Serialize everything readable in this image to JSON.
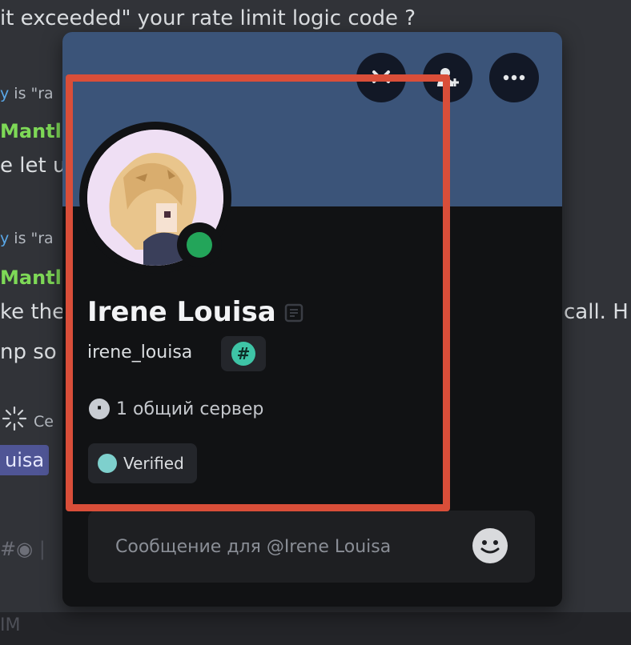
{
  "background": {
    "top_line": "it exceeded\"  your  rate limit logic code ?",
    "fragments": [
      {
        "key": "is_ra_1",
        "pre": "y",
        "text": " is  \"ra"
      },
      {
        "key": "mantle_1",
        "text": "Mantl"
      },
      {
        "key": "let_us",
        "text": "e let us"
      },
      {
        "key": "is_ra_2",
        "pre": "y",
        "text": " is  \"ra"
      },
      {
        "key": "mantle_2",
        "text": "Mantl"
      },
      {
        "key": "ke_the",
        "text": "ke the"
      },
      {
        "key": "np_so",
        "text": "np so"
      },
      {
        "key": "call_h",
        "text": "call.  H"
      },
      {
        "key": "ce",
        "text": "Ce"
      }
    ],
    "mention": "uisa",
    "bottom_fragment": "IM"
  },
  "popup": {
    "display_name": "Irene Louisa",
    "username": "irene_louisa",
    "hash_badge": "#",
    "mutual_servers": "1 общий сервер",
    "verified_label": "Verified",
    "message_placeholder": "Сообщение для @Irene Louisa",
    "status": "online",
    "colors": {
      "banner": "#3b5479",
      "status": "#23a55a",
      "highlight": "#d94e39",
      "hash_badge": "#3ec4a6",
      "verified_dot": "#7ed0cd"
    },
    "top_buttons": [
      {
        "name": "call-icon"
      },
      {
        "name": "add-friend-icon"
      },
      {
        "name": "more-options-icon"
      }
    ]
  }
}
